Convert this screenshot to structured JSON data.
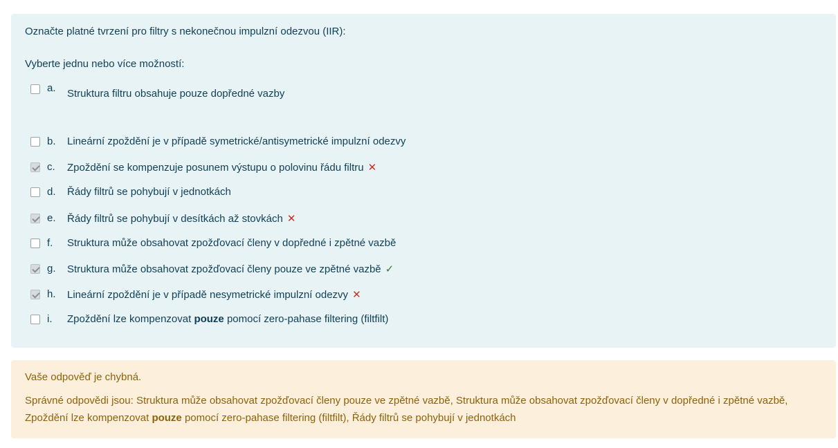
{
  "question": {
    "text": "Označte platné tvrzení pro filtry s nekonečnou impulzní odezvou (IIR):",
    "prompt": "Vyberte jednu nebo více možností:",
    "options": [
      {
        "letter": "a.",
        "text": "Struktura filtru obsahuje pouze dopředné vazby",
        "checked": false,
        "mark": ""
      },
      {
        "letter": "b.",
        "text": "Lineární zpoždění je v případě symetrické/antisymetrické impulzní odezvy",
        "checked": false,
        "mark": ""
      },
      {
        "letter": "c.",
        "text": "Zpoždění se kompenzuje posunem výstupu o polovinu řádu filtru",
        "checked": true,
        "mark": "✕"
      },
      {
        "letter": "d.",
        "text": "Řády filtrů se pohybují v jednotkách",
        "checked": false,
        "mark": ""
      },
      {
        "letter": "e.",
        "text": "Řády filtrů se pohybují v desítkách až stovkách",
        "checked": true,
        "mark": "✕"
      },
      {
        "letter": "f.",
        "text": "Struktura může obsahovat zpožďovací členy v dopředné i zpětné vazbě",
        "checked": false,
        "mark": ""
      },
      {
        "letter": "g.",
        "text": "Struktura může obsahovat zpožďovací členy pouze ve zpětné vazbě",
        "checked": true,
        "mark": "✓"
      },
      {
        "letter": "h.",
        "text": "Lineární zpoždění je v případě nesymetrické impulzní odezvy",
        "checked": true,
        "mark": "✕"
      },
      {
        "letter": "i.",
        "text_before": "Zpoždění lze kompenzovat ",
        "text_bold": "pouze",
        "text_after": " pomocí zero-pahase filtering (filtfilt)",
        "checked": false,
        "mark": ""
      }
    ]
  },
  "feedback": {
    "title": "Vaše odpověď je chybná.",
    "answers_part1": "Správné odpovědi jsou: Struktura může obsahovat zpožďovací členy pouze ve zpětné vazbě, Struktura může obsahovat zpožďovací členy v dopředné i zpětné vazbě, Zpoždění lze kompenzovat ",
    "answers_bold": "pouze",
    "answers_part2": " pomocí zero-pahase filtering (filtfilt), Řády filtrů se pohybují v jednotkách"
  },
  "colors": {
    "question_bg": "#e7f3f5",
    "feedback_bg": "#fcefdc",
    "text_dark": "#0f3f57",
    "feedback_text": "#8e6209",
    "incorrect": "#ca3120",
    "correct": "#357a32"
  }
}
